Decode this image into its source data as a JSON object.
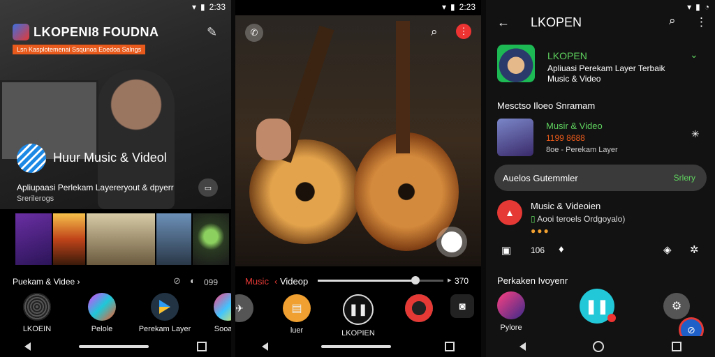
{
  "status": {
    "time": "2:33",
    "time2": "2:23"
  },
  "p1": {
    "app_title": "LKOPENI8 FOUDNA",
    "app_subtitle": "Lsn Kasplotemenai Ssqunoa Eoedoa Salngs",
    "featured_title": "Huur Music & Videol",
    "featured_desc": "Apliupaasi Perlekam Layereryout & dpyerr",
    "featured_sub": "Srerilerogs",
    "section_label": "Puekam & Videe",
    "section_chevron": "›",
    "time_label": "099",
    "tabs": [
      {
        "label": "LKOEIN"
      },
      {
        "label": "Pelole"
      },
      {
        "label": "Perekam Layer"
      },
      {
        "label": "Sooater"
      }
    ],
    "colors": {
      "accent": "#e85a1b"
    }
  },
  "p2": {
    "label_music": "Music",
    "label_video": "Videop",
    "time": "370",
    "progress": 0.78,
    "tabs": [
      {
        "label": "luer"
      },
      {
        "label": "LKOPIEN"
      }
    ]
  },
  "p3": {
    "title": "LKOPEN",
    "app_name": "LKOPEN",
    "app_desc": "Apliuasi Perekam Layer Terbaik",
    "app_desc2": "Music & Video",
    "section1": "Mesctso Iloeo Snramam",
    "item1_title": "Musir & Video",
    "item1_count": "1199 8688",
    "item1_sub": "8oe - Perekam Layer",
    "pill_label": "Auelos Gutemmler",
    "pill_action": "Srlery",
    "item2_title": "Music & Videoien",
    "item2_sub": "Aooi teroels Ordgoyalo)",
    "count": "106",
    "section2": "Perkaken Ivoyenr",
    "bottom_label": "Pylore",
    "colors": {
      "green": "#5fd35f",
      "cyan": "#22c8d8",
      "red": "#e33"
    }
  }
}
